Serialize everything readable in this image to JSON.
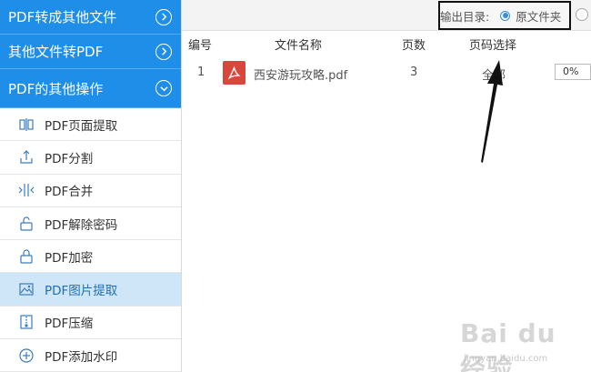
{
  "sidebar": {
    "categories": [
      {
        "label": "PDF转成其他文件"
      },
      {
        "label": "其他文件转PDF"
      },
      {
        "label": "PDF的其他操作"
      }
    ],
    "items": [
      {
        "label": "PDF页面提取",
        "icon": "page-extract-icon"
      },
      {
        "label": "PDF分割",
        "icon": "split-icon"
      },
      {
        "label": "PDF合并",
        "icon": "merge-icon"
      },
      {
        "label": "PDF解除密码",
        "icon": "unlock-icon"
      },
      {
        "label": "PDF加密",
        "icon": "lock-icon"
      },
      {
        "label": "PDF图片提取",
        "icon": "image-extract-icon"
      },
      {
        "label": "PDF压缩",
        "icon": "compress-icon"
      },
      {
        "label": "PDF添加水印",
        "icon": "add-watermark-icon"
      }
    ],
    "active_index": 5
  },
  "toolbar": {
    "output_label": "输出目录:",
    "output_option": "原文件夹"
  },
  "table": {
    "headers": [
      "编号",
      "文件名称",
      "页数",
      "页码选择"
    ],
    "rows": [
      {
        "index": "1",
        "filename": "西安游玩攻略.pdf",
        "pages": "3",
        "page_select": "全部",
        "progress": "0%"
      }
    ]
  },
  "watermark": {
    "logo": "Bai du 经验",
    "url": "jingyan.baidu.com"
  },
  "colors": {
    "accent": "#1e8ee8",
    "active_bg": "#cfe6f8",
    "pdf_icon": "#d8473c"
  }
}
